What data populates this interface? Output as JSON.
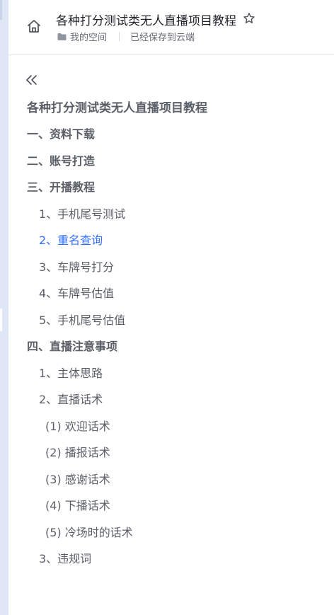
{
  "header": {
    "title": "各种打分测试类无人直播项目教程",
    "space_label": "我的空间",
    "save_status": "已经保存到云端"
  },
  "toc": {
    "items": [
      {
        "label": "各种打分测试类无人直播项目教程",
        "level": 0
      },
      {
        "label": "一、资料下载",
        "level": 1
      },
      {
        "label": "二、账号打造",
        "level": 1
      },
      {
        "label": "三、开播教程",
        "level": 1
      },
      {
        "label": "1、手机尾号测试",
        "level": 2
      },
      {
        "label": "2、重名查询",
        "level": 2,
        "active": true
      },
      {
        "label": "3、车牌号打分",
        "level": 2
      },
      {
        "label": "4、车牌号估值",
        "level": 2
      },
      {
        "label": "5、手机尾号估值",
        "level": 2
      },
      {
        "label": "四、直播注意事项",
        "level": 1
      },
      {
        "label": "1、主体思路",
        "level": 2
      },
      {
        "label": "2、直播话术",
        "level": 2
      },
      {
        "label": "(1) 欢迎话术",
        "level": 3
      },
      {
        "label": "(2) 播报话术",
        "level": 3
      },
      {
        "label": "(3) 感谢话术",
        "level": 3
      },
      {
        "label": "(4) 下播话术",
        "level": 3
      },
      {
        "label": "(5) 冷场时的话术",
        "level": 3
      },
      {
        "label": "3、违规词",
        "level": 2
      }
    ]
  },
  "colors": {
    "accent": "#3370ff",
    "text": "#5b6068",
    "title": "#1f2329",
    "side_strip": "#dfe7f6"
  },
  "icons": {
    "home": "home-icon",
    "star": "star-outline-icon",
    "folder": "folder-icon",
    "collapse": "double-chevron-left-icon"
  }
}
